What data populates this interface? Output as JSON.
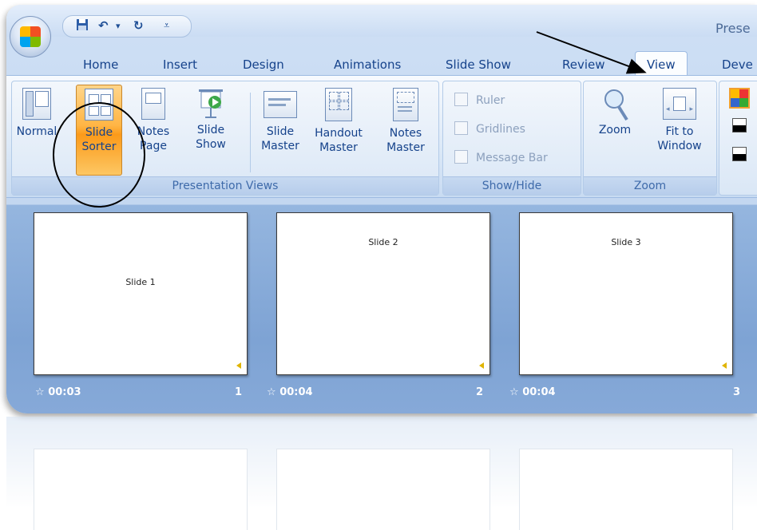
{
  "window": {
    "title": "Prese"
  },
  "qat": {
    "save_icon": "save-icon",
    "undo_glyph": "↶",
    "dropdown_glyph": "▾",
    "redo_glyph": "↻",
    "customize_glyph": "⩡"
  },
  "tabs": [
    {
      "label": "Home"
    },
    {
      "label": "Insert"
    },
    {
      "label": "Design"
    },
    {
      "label": "Animations"
    },
    {
      "label": "Slide Show"
    },
    {
      "label": "Review"
    },
    {
      "label": "View",
      "active": true
    },
    {
      "label": "Deve"
    }
  ],
  "ribbon": {
    "presentation_views": {
      "label": "Presentation Views",
      "buttons": [
        {
          "line1": "Normal",
          "line2": ""
        },
        {
          "line1": "Slide",
          "line2": "Sorter",
          "selected": true
        },
        {
          "line1": "Notes",
          "line2": "Page"
        },
        {
          "line1": "Slide",
          "line2": "Show"
        },
        {
          "line1": "Slide",
          "line2": "Master"
        },
        {
          "line1": "Handout",
          "line2": "Master"
        },
        {
          "line1": "Notes",
          "line2": "Master"
        }
      ]
    },
    "show_hide": {
      "label": "Show/Hide",
      "checkboxes": [
        {
          "label": "Ruler",
          "checked": false
        },
        {
          "label": "Gridlines",
          "checked": false
        },
        {
          "label": "Message Bar",
          "checked": false
        }
      ]
    },
    "zoom": {
      "label": "Zoom",
      "buttons": [
        {
          "line1": "Zoom",
          "line2": ""
        },
        {
          "line1": "Fit to",
          "line2": "Window"
        }
      ]
    }
  },
  "slides": [
    {
      "title": "Slide 1",
      "time": "00:03",
      "number": "1"
    },
    {
      "title": "Slide 2",
      "time": "00:04",
      "number": "2"
    },
    {
      "title": "Slide 3",
      "time": "00:04",
      "number": "3"
    }
  ],
  "colors": {
    "selected": "#ffb545",
    "tab_text": "#15428b",
    "group_label": "#3e6aaa"
  }
}
